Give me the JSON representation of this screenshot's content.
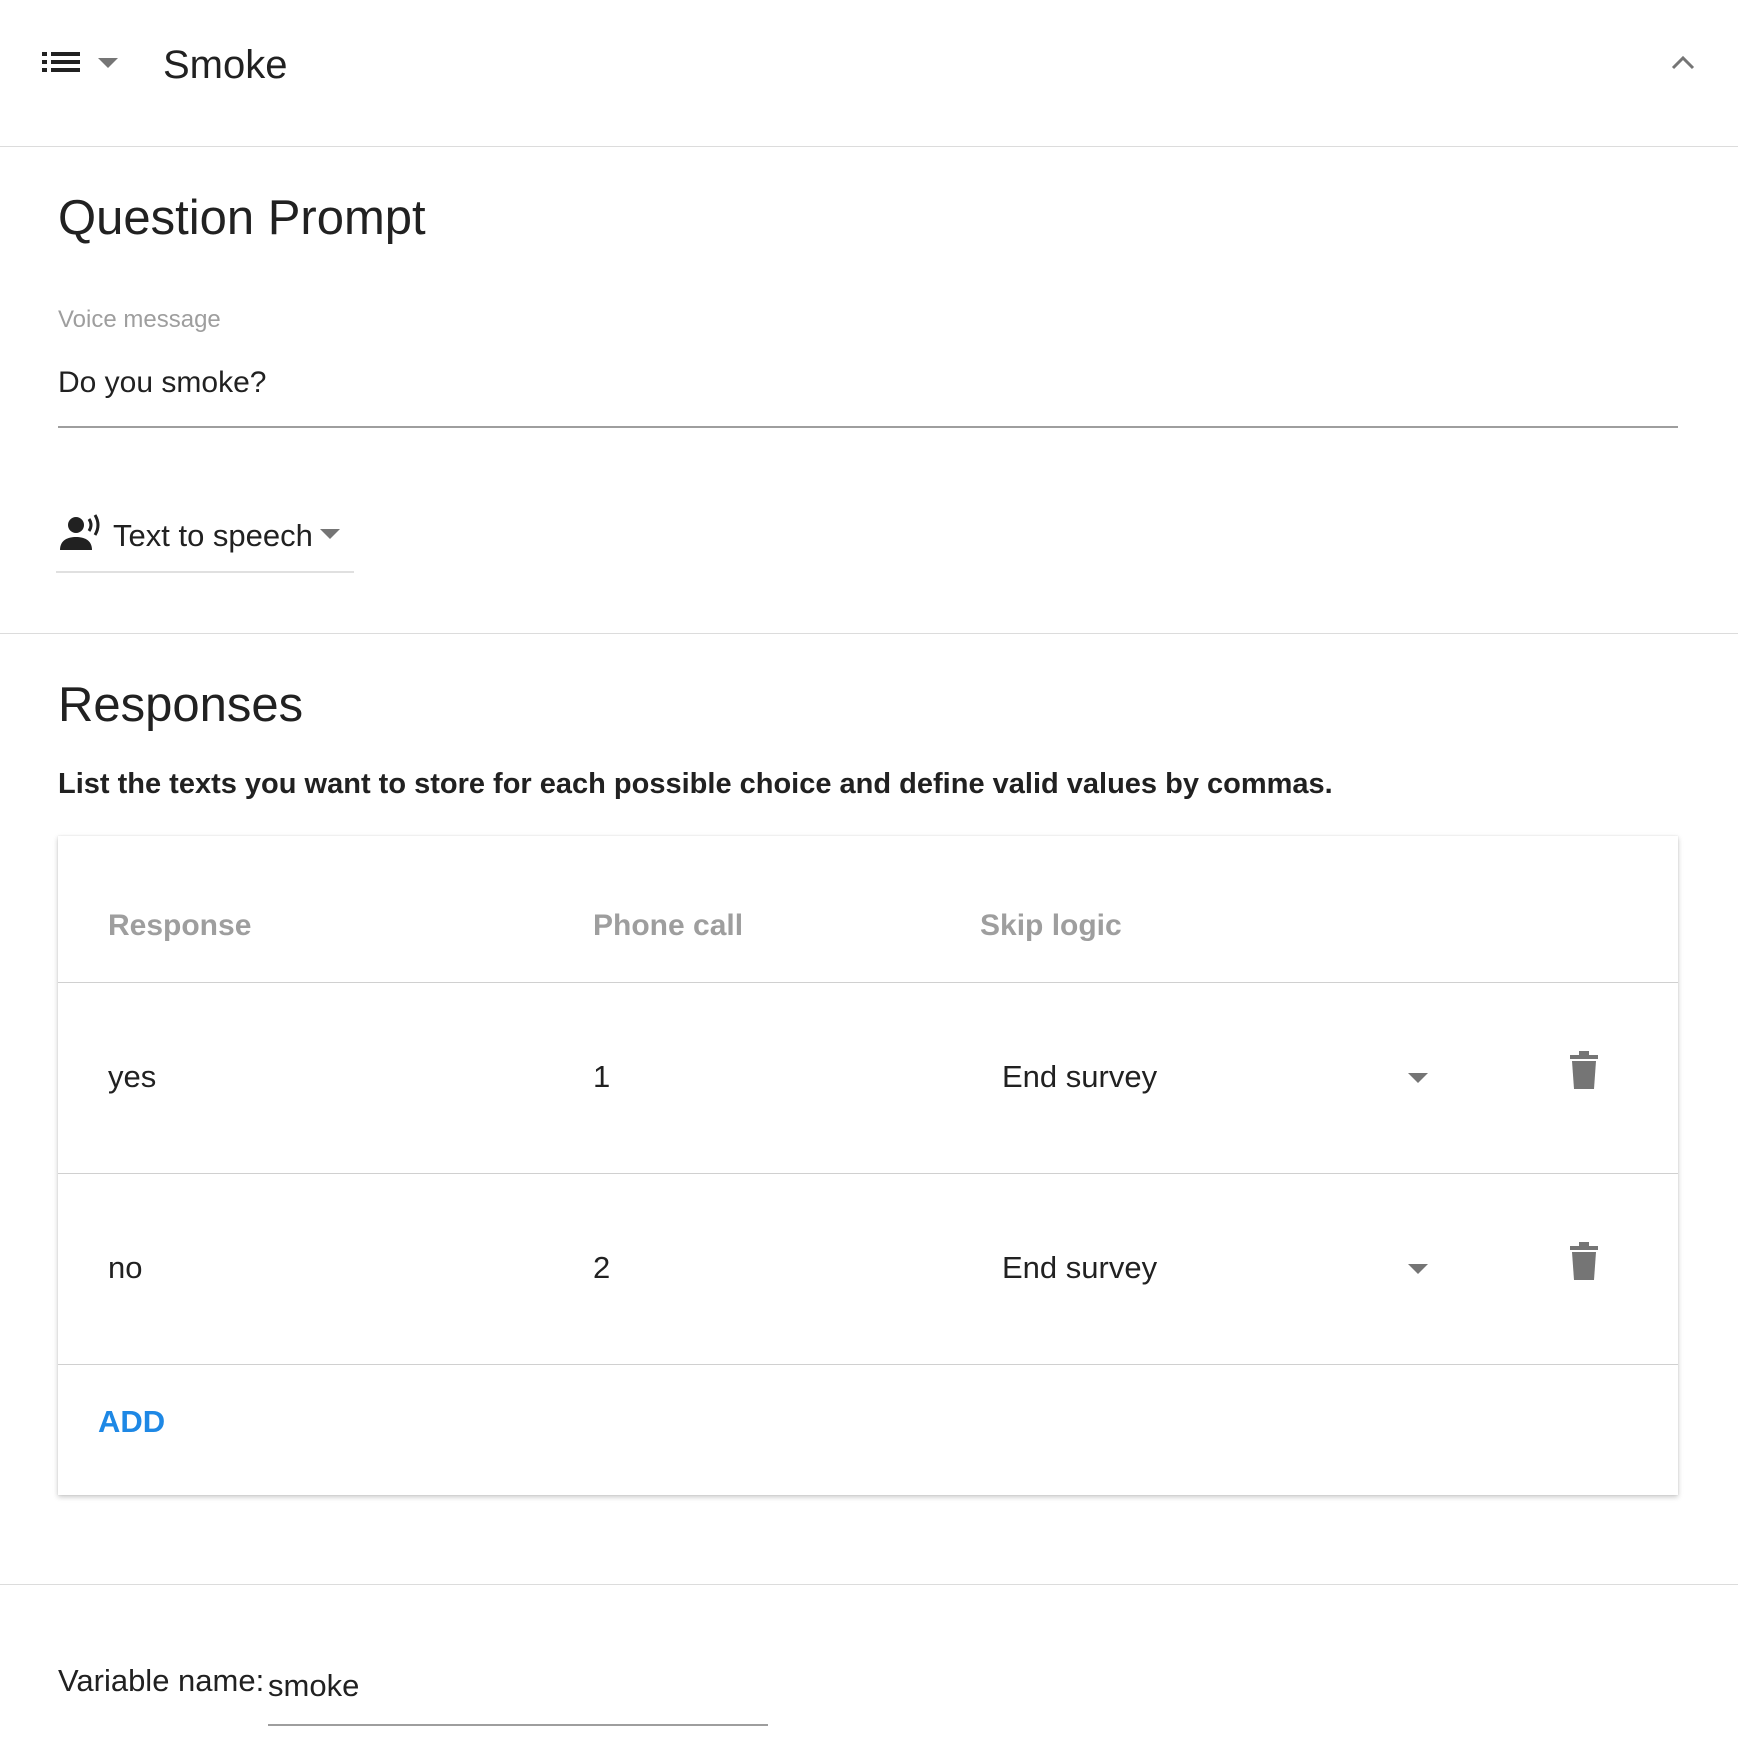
{
  "header": {
    "title": "Smoke",
    "type_icon": "list-icon",
    "collapse_icon": "chevron-up-icon"
  },
  "question_prompt": {
    "title": "Question Prompt",
    "voice_message_label": "Voice message",
    "voice_message_value": "Do you smoke?",
    "mode_icon": "record-voice-icon",
    "mode_label": "Text to speech"
  },
  "responses": {
    "title": "Responses",
    "description": "List the texts you want to store for each possible choice and define valid values by commas.",
    "columns": [
      "Response",
      "Phone call",
      "Skip logic"
    ],
    "rows": [
      {
        "response": "yes",
        "phone_call": "1",
        "skip_logic": "End survey"
      },
      {
        "response": "no",
        "phone_call": "2",
        "skip_logic": "End survey"
      }
    ],
    "add_label": "ADD",
    "delete_icon": "trash-icon"
  },
  "variable": {
    "label": "Variable name:",
    "value": "smoke"
  },
  "colors": {
    "accent": "#1e88e5",
    "text": "#212121",
    "muted": "#9e9e9e",
    "divider": "#dcdcdc"
  }
}
